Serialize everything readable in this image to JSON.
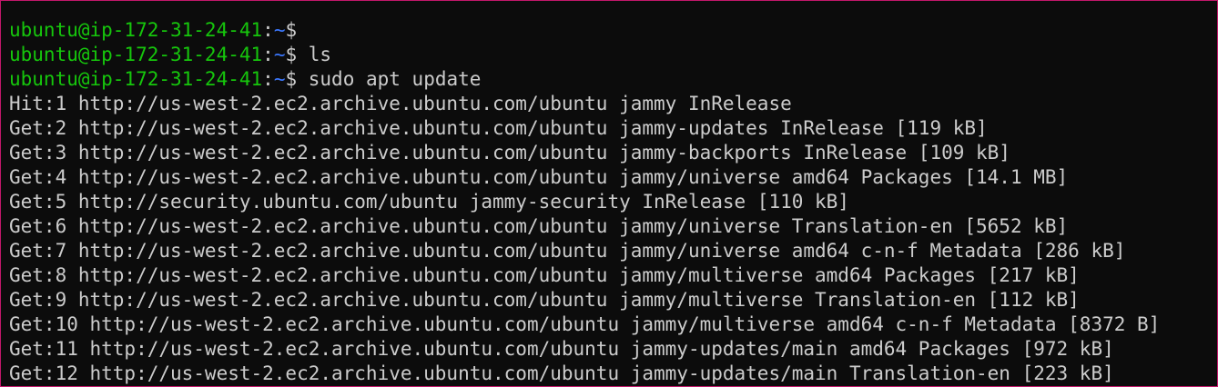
{
  "terminal": {
    "prompt": {
      "user_host": "ubuntu@ip-172-31-24-41",
      "colon": ":",
      "path": "~",
      "symbol": "$"
    },
    "commands": [
      "",
      " ls",
      " sudo apt update"
    ],
    "output": [
      "Hit:1 http://us-west-2.ec2.archive.ubuntu.com/ubuntu jammy InRelease",
      "Get:2 http://us-west-2.ec2.archive.ubuntu.com/ubuntu jammy-updates InRelease [119 kB]",
      "Get:3 http://us-west-2.ec2.archive.ubuntu.com/ubuntu jammy-backports InRelease [109 kB]",
      "Get:4 http://us-west-2.ec2.archive.ubuntu.com/ubuntu jammy/universe amd64 Packages [14.1 MB]",
      "Get:5 http://security.ubuntu.com/ubuntu jammy-security InRelease [110 kB]",
      "Get:6 http://us-west-2.ec2.archive.ubuntu.com/ubuntu jammy/universe Translation-en [5652 kB]",
      "Get:7 http://us-west-2.ec2.archive.ubuntu.com/ubuntu jammy/universe amd64 c-n-f Metadata [286 kB]",
      "Get:8 http://us-west-2.ec2.archive.ubuntu.com/ubuntu jammy/multiverse amd64 Packages [217 kB]",
      "Get:9 http://us-west-2.ec2.archive.ubuntu.com/ubuntu jammy/multiverse Translation-en [112 kB]",
      "Get:10 http://us-west-2.ec2.archive.ubuntu.com/ubuntu jammy/multiverse amd64 c-n-f Metadata [8372 B]",
      "Get:11 http://us-west-2.ec2.archive.ubuntu.com/ubuntu jammy-updates/main amd64 Packages [972 kB]",
      "Get:12 http://us-west-2.ec2.archive.ubuntu.com/ubuntu jammy-updates/main Translation-en [223 kB]"
    ]
  }
}
